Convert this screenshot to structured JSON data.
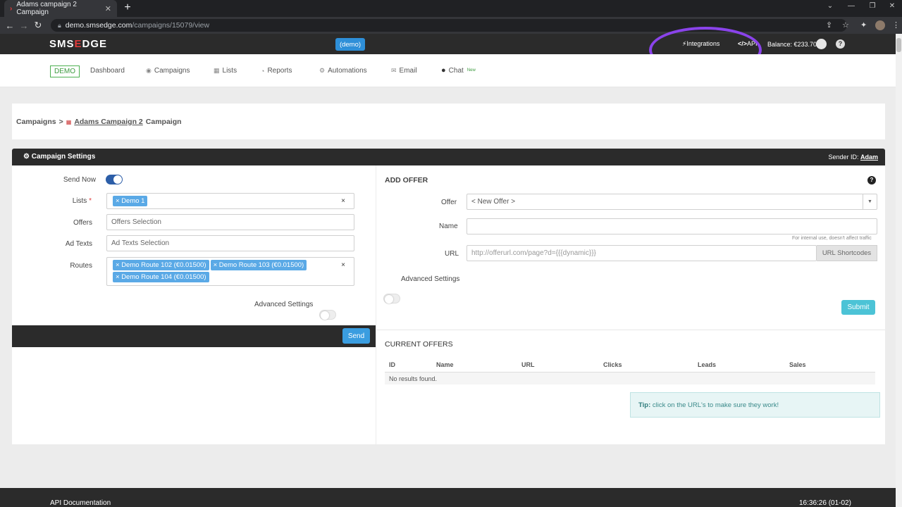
{
  "browser": {
    "tab_title": "Adams campaign 2 Campaign",
    "url_domain": "demo.smsedge.com",
    "url_path": "/campaigns/15079/view"
  },
  "header": {
    "logo_left": "SMS",
    "logo_mid": "E",
    "logo_right": "DGE",
    "demo_badge": "(demo)",
    "integrations": "Integrations",
    "api": "API",
    "balance": "Balance: €233.70"
  },
  "nav": {
    "demo_tag": "DEMO",
    "items": [
      {
        "label": "Dashboard",
        "icon": "dashboard-icon"
      },
      {
        "label": "Campaigns",
        "icon": "campaigns-icon"
      },
      {
        "label": "Lists",
        "icon": "lists-icon"
      },
      {
        "label": "Reports",
        "icon": "reports-icon"
      },
      {
        "label": "Automations",
        "icon": "automations-icon"
      },
      {
        "label": "Email",
        "icon": "email-icon"
      },
      {
        "label": "Chat",
        "icon": "chat-icon",
        "sup": "New"
      }
    ]
  },
  "breadcrumb": {
    "root": "Campaigns",
    "sep": ">",
    "link": "Adams Campaign 2",
    "suffix": "Campaign"
  },
  "settings": {
    "title": "Campaign Settings",
    "sender_label": "Sender ID:",
    "sender_value": "Adam",
    "send_now_label": "Send Now",
    "send_now_on": true,
    "lists_label": "Lists",
    "lists_chips": [
      "Demo 1"
    ],
    "offers_label": "Offers",
    "offers_placeholder": "Offers Selection",
    "adtexts_label": "Ad Texts",
    "adtexts_placeholder": "Ad Texts Selection",
    "routes_label": "Routes",
    "routes_chips": [
      "Demo Route 102 (€0.01500)",
      "Demo Route 103 (€0.01500)",
      "Demo Route 104 (€0.01500)"
    ],
    "advanced_label": "Advanced Settings",
    "send_button": "Send"
  },
  "add_offer": {
    "title": "ADD OFFER",
    "offer_label": "Offer",
    "offer_value": "< New Offer >",
    "name_label": "Name",
    "name_hint": "For internal use, doesn't affect traffic",
    "url_label": "URL",
    "url_placeholder": "http://offerurl.com/page?d={{{dynamic}}}",
    "url_shortcodes": "URL Shortcodes",
    "advanced_label": "Advanced Settings",
    "submit": "Submit"
  },
  "current_offers": {
    "title": "CURRENT OFFERS",
    "columns": [
      "ID",
      "Name",
      "URL",
      "Clicks",
      "Leads",
      "Sales"
    ],
    "empty": "No results found.",
    "tip_bold": "Tip:",
    "tip_text": "click on the URL's to make sure they work!"
  },
  "footer": {
    "left": "API Documentation",
    "right": "16:36:26 (01-02)"
  },
  "colors": {
    "accent": "#3a9de0",
    "header": "#2b2b2b",
    "brand_red": "#e03b3b",
    "annotation": "#8a43ea"
  }
}
